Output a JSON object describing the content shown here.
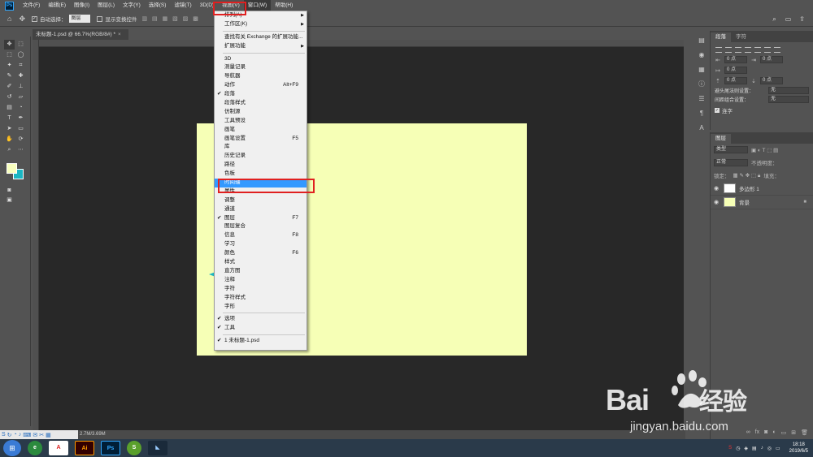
{
  "menubar": {
    "logo": "Ps",
    "items": [
      "文件(F)",
      "编辑(E)",
      "图像(I)",
      "图层(L)",
      "文字(Y)",
      "选择(S)",
      "滤镜(T)",
      "3D(D)",
      "视图(V)",
      "窗口(W)",
      "帮助(H)"
    ]
  },
  "options": {
    "auto_select_label": "自动选择：",
    "auto_select_value": "图层",
    "show_transform_label": "显示变换控件"
  },
  "document": {
    "tab_title": "未标题-1.psd @ 66.7%(RGB/8#) *",
    "status": "2.7M/3.69M"
  },
  "colors": {
    "foreground": "#f8ffbe",
    "background": "#1ab6c2",
    "artboard": "#f6ffb6",
    "highlight": "#3399ff",
    "annotation": "#e02020"
  },
  "window_menu": {
    "items": [
      {
        "label": "排列(A)",
        "submenu": true
      },
      {
        "label": "工作区(K)",
        "submenu": true
      },
      {
        "sep": true
      },
      {
        "label": "查找有关 Exchange 的扩展功能..."
      },
      {
        "label": "扩展功能",
        "submenu": true
      },
      {
        "sep": true
      },
      {
        "label": "3D"
      },
      {
        "label": "测量记录"
      },
      {
        "label": "导航器"
      },
      {
        "label": "动作",
        "shortcut": "Alt+F9"
      },
      {
        "label": "段落",
        "checked": true
      },
      {
        "label": "段落样式"
      },
      {
        "label": "仿制源"
      },
      {
        "label": "工具预设"
      },
      {
        "label": "画笔"
      },
      {
        "label": "画笔设置",
        "shortcut": "F5"
      },
      {
        "label": "库"
      },
      {
        "label": "历史记录"
      },
      {
        "label": "路径"
      },
      {
        "label": "色板"
      },
      {
        "label": "时间轴",
        "highlighted": true
      },
      {
        "label": "属性"
      },
      {
        "label": "调整"
      },
      {
        "label": "通道"
      },
      {
        "label": "图层",
        "checked": true,
        "shortcut": "F7"
      },
      {
        "label": "图层复合"
      },
      {
        "label": "信息",
        "shortcut": "F8"
      },
      {
        "label": "学习"
      },
      {
        "label": "颜色",
        "shortcut": "F6"
      },
      {
        "label": "样式"
      },
      {
        "label": "直方图"
      },
      {
        "label": "注释"
      },
      {
        "label": "字符"
      },
      {
        "label": "字符样式"
      },
      {
        "label": "字形"
      },
      {
        "sep": true
      },
      {
        "label": "选项",
        "checked": true
      },
      {
        "label": "工具",
        "checked": true
      },
      {
        "sep": true
      },
      {
        "label": "1 未标题-1.psd",
        "checked": true
      }
    ]
  },
  "paragraph_panel": {
    "tabs": [
      "段落",
      "字符"
    ],
    "indent_values": [
      "0 点",
      "0 点",
      "0 点",
      "0 点",
      "0 点"
    ],
    "hyphen_label": "避头尾法则设置：",
    "hyphen_value": "无",
    "spacing_label": "间距组合设置：",
    "spacing_value": "无",
    "hyphenate_label": "连字"
  },
  "layers_panel": {
    "title": "图层",
    "filter_value": "类型",
    "blend_mode": "正常",
    "opacity_label": "不透明度：",
    "lock_label": "锁定：",
    "fill_label": "填充：",
    "layers": [
      {
        "name": "多边形 1",
        "thumb": "#ffffff"
      },
      {
        "name": "背景",
        "thumb": "#f6ffb6",
        "locked": true
      }
    ]
  },
  "watermark": {
    "brand_left": "Bai",
    "brand_right": "经验",
    "url": "jingyan.baidu.com"
  },
  "taskbar": {
    "apps": [
      "e",
      "A",
      "Ai",
      "Ps",
      "S",
      "◣"
    ],
    "time": "18:18",
    "date": "2019/6/5"
  }
}
